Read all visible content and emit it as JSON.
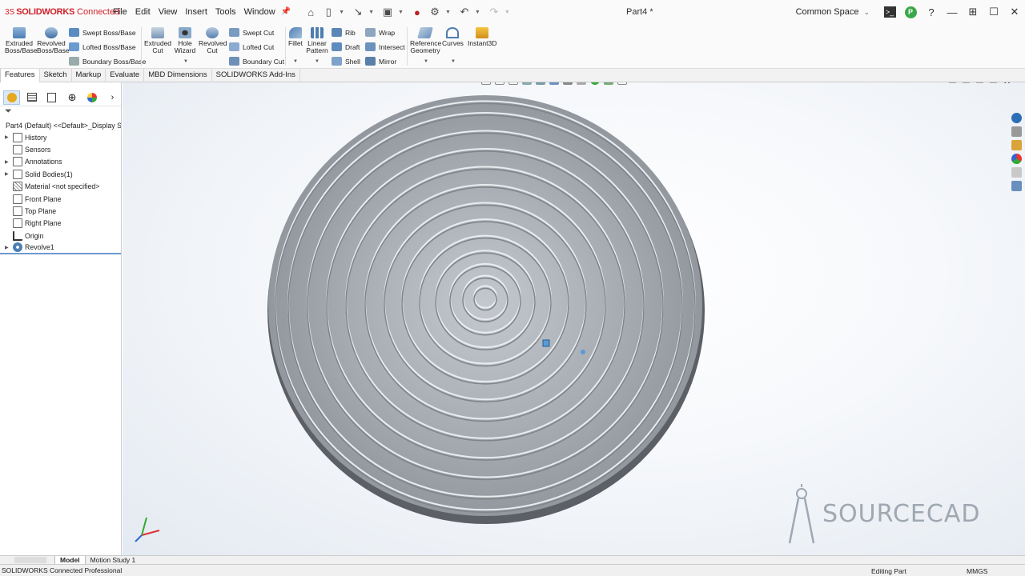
{
  "app": {
    "brand_logo": "SOLIDWORKS",
    "brand_sub": "Connected",
    "document_title": "Part4 *",
    "workspace": "Common Space",
    "avatar_initial": "P"
  },
  "menu": [
    "File",
    "Edit",
    "View",
    "Insert",
    "Tools",
    "Window"
  ],
  "ribbon": {
    "extruded_boss": [
      "Extruded",
      "Boss/Base"
    ],
    "revolved_boss": [
      "Revolved",
      "Boss/Base"
    ],
    "swept_boss": "Swept Boss/Base",
    "lofted_boss": "Lofted Boss/Base",
    "boundary_boss": "Boundary Boss/Base",
    "extruded_cut": [
      "Extruded",
      "Cut"
    ],
    "hole_wizard": [
      "Hole",
      "Wizard"
    ],
    "revolved_cut": [
      "Revolved",
      "Cut"
    ],
    "swept_cut": "Swept Cut",
    "lofted_cut": "Lofted Cut",
    "boundary_cut": "Boundary Cut",
    "fillet": "Fillet",
    "linear_pattern": [
      "Linear",
      "Pattern"
    ],
    "rib": "Rib",
    "draft": "Draft",
    "shell": "Shell",
    "wrap": "Wrap",
    "intersect": "Intersect",
    "mirror": "Mirror",
    "reference_geometry": [
      "Reference",
      "Geometry"
    ],
    "curves": "Curves",
    "instant3d": "Instant3D"
  },
  "tabs": [
    "Features",
    "Sketch",
    "Markup",
    "Evaluate",
    "MBD Dimensions",
    "SOLIDWORKS Add-Ins"
  ],
  "tree": {
    "root": "Part4 (Default) <<Default>_Display St",
    "items": [
      {
        "label": "History",
        "expandable": true
      },
      {
        "label": "Sensors",
        "expandable": false
      },
      {
        "label": "Annotations",
        "expandable": true
      },
      {
        "label": "Solid Bodies(1)",
        "expandable": true
      },
      {
        "label": "Material <not specified>",
        "expandable": false
      },
      {
        "label": "Front Plane",
        "expandable": false
      },
      {
        "label": "Top Plane",
        "expandable": false
      },
      {
        "label": "Right Plane",
        "expandable": false
      },
      {
        "label": "Origin",
        "expandable": false
      },
      {
        "label": "Revolve1",
        "expandable": true
      }
    ]
  },
  "watermark": "SOURCECAD",
  "bottom_tabs": [
    "Model",
    "Motion Study 1"
  ],
  "status": {
    "left": "SOLIDWORKS Connected Professional",
    "mode": "Editing Part",
    "units": "MMGS"
  },
  "colors": {
    "brand_red": "#d0202a",
    "tree_selection": "#6c9ad0",
    "part_gray": "#a7acb3"
  }
}
